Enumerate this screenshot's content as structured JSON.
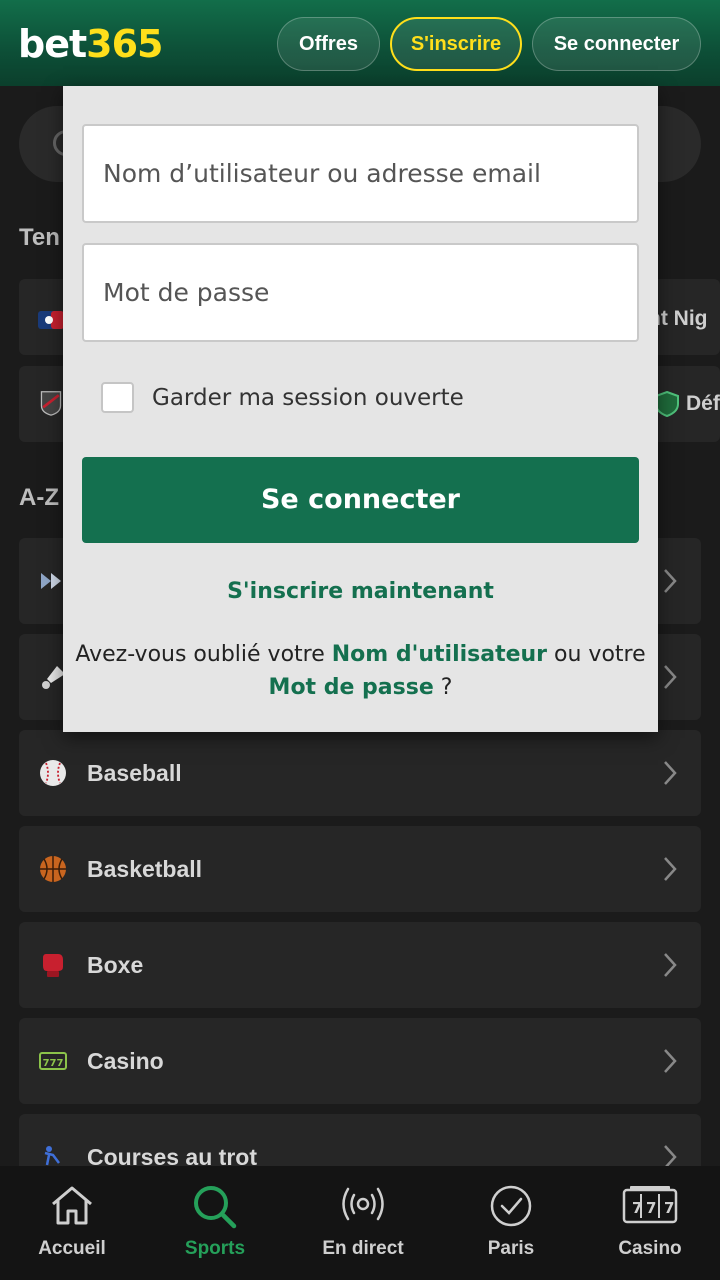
{
  "header": {
    "logo_part1": "bet",
    "logo_part2": "365",
    "offers_label": "Offres",
    "register_label": "S'inscrire",
    "login_label": "Se connecter"
  },
  "background": {
    "section_featured": "Ten",
    "section_az": "A-Z",
    "tile_right_top": "ht Nig",
    "tile_right_bottom": "Déf",
    "az_items": [
      {
        "label": "Baseball",
        "icon": "baseball-icon"
      },
      {
        "label": "Basketball",
        "icon": "basketball-icon"
      },
      {
        "label": "Boxe",
        "icon": "boxing-glove-icon"
      },
      {
        "label": "Casino",
        "icon": "slot-777-icon"
      },
      {
        "label": "Courses au trot",
        "icon": "harness-racing-icon"
      }
    ]
  },
  "login_modal": {
    "username_placeholder": "Nom d’utilisateur ou adresse email",
    "password_placeholder": "Mot de passe",
    "remember_label": "Garder ma session ouverte",
    "submit_label": "Se connecter",
    "register_now": "S'inscrire maintenant",
    "forgot_prefix": "Avez-vous oublié votre ",
    "forgot_username": "Nom d'utilisateur",
    "forgot_middle": " ou votre ",
    "forgot_password": "Mot de passe",
    "forgot_suffix": " ?"
  },
  "bottom_nav": [
    {
      "label": "Accueil",
      "icon": "home-icon"
    },
    {
      "label": "Sports",
      "icon": "search-icon",
      "active": true
    },
    {
      "label": "En direct",
      "icon": "live-broadcast-icon"
    },
    {
      "label": "Paris",
      "icon": "check-circle-icon"
    },
    {
      "label": "Casino",
      "icon": "slot-777-icon"
    }
  ],
  "colors": {
    "brand_green": "#14704f",
    "logo_yellow": "#ffdf1b",
    "active_nav": "#25a05a"
  }
}
